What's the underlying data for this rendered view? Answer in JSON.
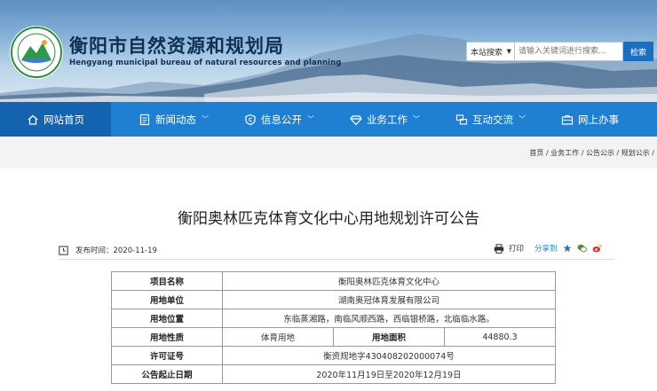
{
  "site": {
    "title": "衡阳市自然资源和规划局",
    "subtitle": "Hengyang municipal bureau of natural resources and planning"
  },
  "search": {
    "scope": "本站搜索",
    "placeholder": "请输入关键词进行搜索...",
    "button": "检索"
  },
  "nav": [
    {
      "label": "网站首页",
      "icon": "home-icon"
    },
    {
      "label": "新闻动态",
      "icon": "news-icon"
    },
    {
      "label": "信息公开",
      "icon": "info-icon"
    },
    {
      "label": "业务工作",
      "icon": "diamond-icon"
    },
    {
      "label": "互动交流",
      "icon": "interact-icon"
    },
    {
      "label": "网上办事",
      "icon": "briefcase-icon"
    }
  ],
  "breadcrumb": "首页 / 业务工作 / 公告公示 / 规划公示 /",
  "article": {
    "title": "衡阳奥林匹克体育文化中心用地规划许可公告",
    "date_label": "发布时间：2020-11-19",
    "print": "打印",
    "share": "分享到"
  },
  "table": {
    "project_name_k": "项目名称",
    "project_name_v": "衡阳奥林匹克体育文化中心",
    "unit_k": "用地单位",
    "unit_v": "湖南奥冠体育发展有限公司",
    "location_k": "用地位置",
    "location_v": "东临蒸湘路，南临风顺西路，西临银桥路，北临临水路。",
    "nature_k": "用地性质",
    "nature_v": "体育用地",
    "area_k": "用地面积",
    "area_v": "44880.3",
    "permit_k": "许可证号",
    "permit_v": "衡资规地字430408202000074号",
    "period_k": "公告起止日期",
    "period_v": "2020年11月19日至2020年12月19日"
  }
}
